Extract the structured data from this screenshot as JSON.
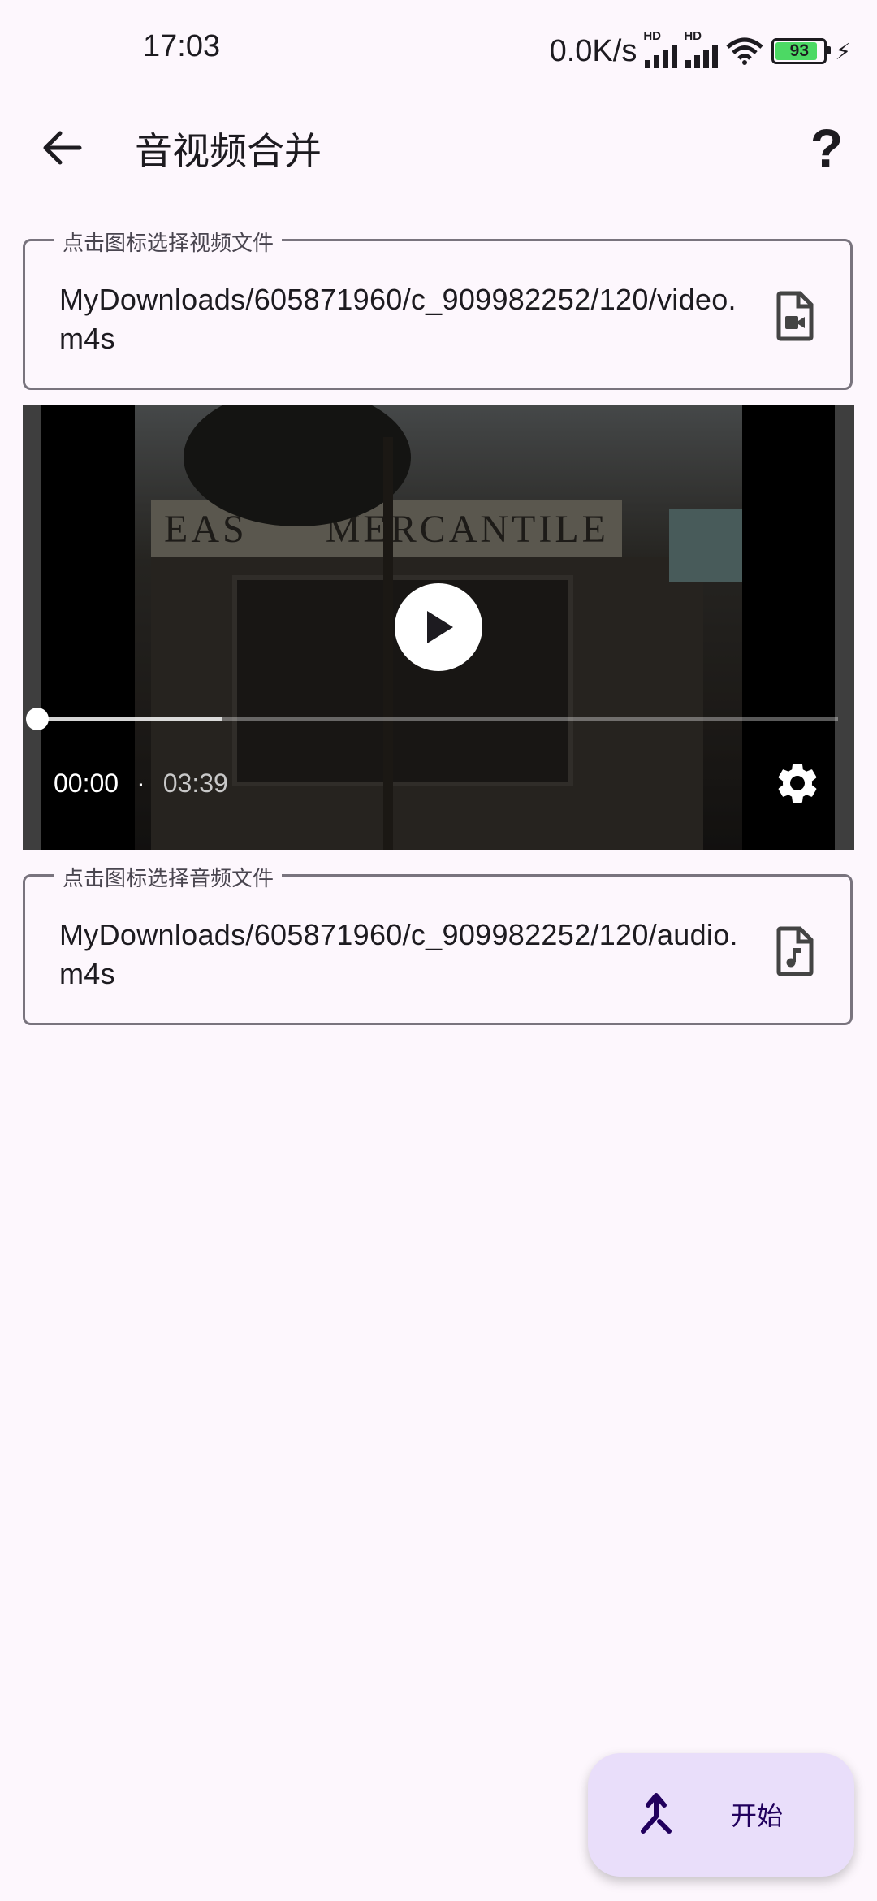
{
  "status_bar": {
    "time": "17:03",
    "net_speed": "0.0K/s",
    "signal1_label": "HD",
    "signal2_label": "HD",
    "battery_level": "93",
    "icons": [
      "signal-icon",
      "signal-icon",
      "wifi-icon",
      "battery-icon",
      "charging-icon"
    ]
  },
  "app_bar": {
    "title": "音视频合并",
    "back_icon": "arrow-back-icon",
    "help_label": "?"
  },
  "video_field": {
    "label": "点击图标选择视频文件",
    "value": "MyDownloads/605871960/c_909982252/120/video.m4s",
    "icon": "video-file-icon"
  },
  "player": {
    "current_time": "00:00",
    "separator": "·",
    "duration": "03:39",
    "progress": 0.0,
    "buffered": 0.23,
    "scene_sign_left": "EAS",
    "scene_sign_right": "MERCANTILE",
    "icons": [
      "play-icon",
      "settings-icon"
    ]
  },
  "audio_field": {
    "label": "点击图标选择音频文件",
    "value": "MyDownloads/605871960/c_909982252/120/audio.m4s",
    "icon": "audio-file-icon"
  },
  "fab": {
    "label": "开始",
    "icon": "merge-icon"
  },
  "colors": {
    "background": "#fdf7fd",
    "outline": "#79747e",
    "fab_container": "#e9defa",
    "fab_content": "#21005d"
  }
}
